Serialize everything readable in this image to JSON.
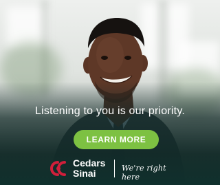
{
  "ad": {
    "headline": "Listening to you is our priority.",
    "cta_label": "LEARN MORE",
    "brand": {
      "name_line1": "Cedars",
      "name_line2": "Sinai",
      "logo_icon": "cedars-sinai-logo-icon",
      "tagline": "We're right here"
    },
    "colors": {
      "cta": "#7dc142",
      "logo_red": "#d11f3b",
      "overlay": "#10302d"
    }
  }
}
